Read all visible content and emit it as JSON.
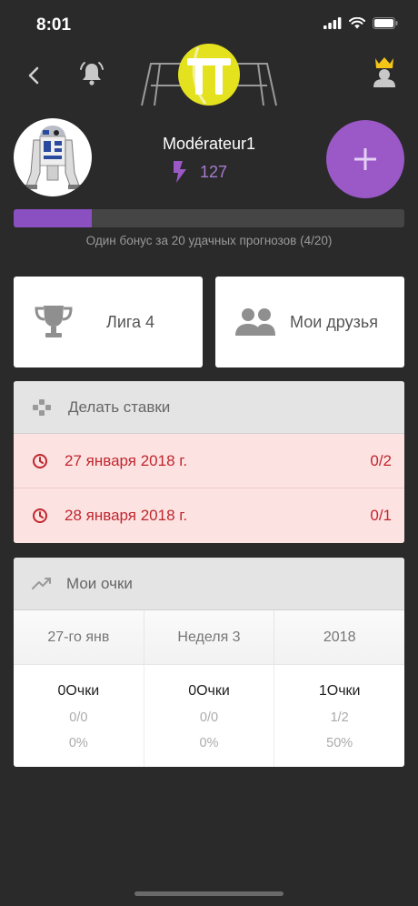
{
  "status_bar": {
    "time": "8:01"
  },
  "nav": {
    "back_icon": "chevron-left-icon",
    "bell_icon": "bell-icon",
    "logo_text": "TT",
    "crown_icon": "crown-user-icon"
  },
  "profile": {
    "username": "Modérateur1",
    "bonus_points": "127",
    "add_label": "+"
  },
  "progress": {
    "fraction": 0.2,
    "text": "Один бонус за 20 удачных прогнозов (4/20)",
    "accent": "#8a4fc0"
  },
  "cards": {
    "league_label": "Лига 4",
    "friends_label": "Мои друзья"
  },
  "bets": {
    "title": "Делать ставки",
    "rows": [
      {
        "date": "27 января 2018 г.",
        "score": "0/2"
      },
      {
        "date": "28 января 2018 г.",
        "score": "0/1"
      }
    ]
  },
  "points": {
    "title": "Мои очки",
    "tabs": [
      "27-го янв",
      "Неделя 3",
      "2018"
    ],
    "columns": [
      {
        "points": "0Очки",
        "ratio": "0/0",
        "percent": "0%"
      },
      {
        "points": "0Очки",
        "ratio": "0/0",
        "percent": "0%"
      },
      {
        "points": "1Очки",
        "ratio": "1/2",
        "percent": "50%"
      }
    ]
  },
  "colors": {
    "background": "#2a2a2a",
    "purple": "#9b59c8",
    "alert_red": "#c0262d",
    "alert_bg": "#fde2e2",
    "logo_yellow": "#e4e21e"
  }
}
